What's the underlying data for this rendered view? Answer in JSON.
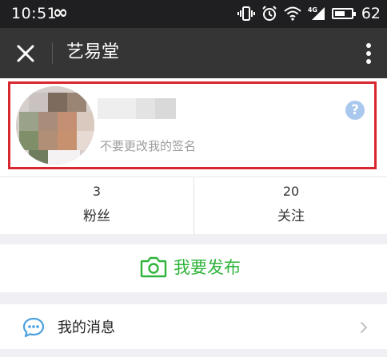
{
  "status_bar": {
    "time": "10:51",
    "infinity_icon": "infinity-icon",
    "network_label": "4G",
    "battery_level": "62",
    "battery_fraction": 0.62
  },
  "title_bar": {
    "title": "艺易堂",
    "close_icon": "close-icon",
    "more_icon": "more-vertical-icon"
  },
  "profile": {
    "signature": "不要更改我的签名",
    "help_glyph": "?",
    "highlight_color": "#d9272e"
  },
  "stats": [
    {
      "count": "3",
      "label": "粉丝"
    },
    {
      "count": "20",
      "label": "关注"
    }
  ],
  "publish": {
    "label": "我要发布",
    "icon": "camera-icon",
    "color": "#2fb43b"
  },
  "messages": {
    "label": "我的消息",
    "icon": "chat-bubble-icon",
    "chevron": "chevron-right-icon"
  }
}
